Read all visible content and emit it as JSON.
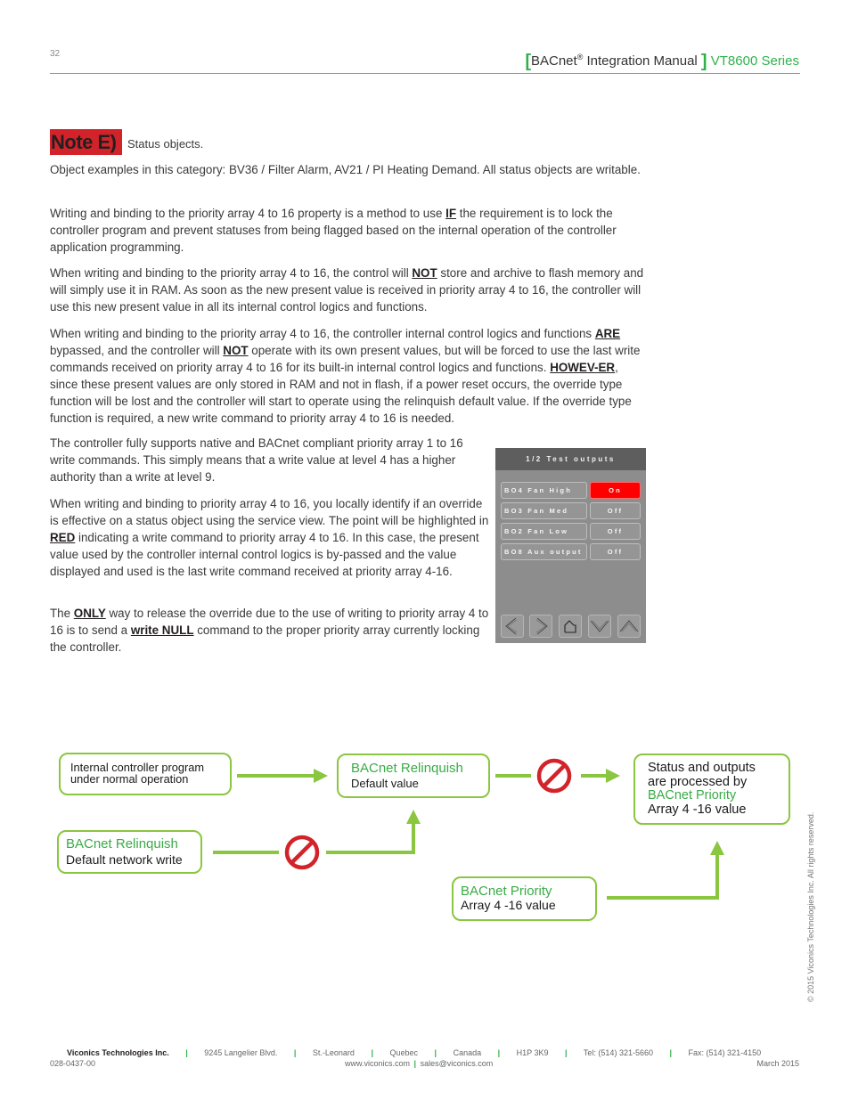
{
  "header": {
    "page_number": "32",
    "title_main": "BACnet",
    "title_reg": "®",
    "title_rest": " Integration Manual",
    "series": "VT8600 Series",
    "bracket_open": "[",
    "bracket_close": "]"
  },
  "note": {
    "badge": "Note E)",
    "subtitle": "Status objects."
  },
  "paragraphs": {
    "p1": "Object examples in this category: BV36 / Filter Alarm, AV21 / PI Heating Demand. All status objects are writable.",
    "p2a": "Writing and binding to the priority array 4 to 16 property is a method to use ",
    "p2b": "IF",
    "p2c": " the requirement is to lock the controller program and prevent statuses from being flagged based on the internal operation of the controller application programming.",
    "p3a": "When writing and binding to the priority array 4 to 16, the control will ",
    "p3b": "NOT",
    "p3c": " store and archive to flash memory and will simply use it in RAM. As soon as the new present value is received in priority array 4 to 16, the controller will use this new present value in all its internal control logics and functions.",
    "p4a": "When writing and binding to the priority array 4 to 16, the controller internal control logics and functions ",
    "p4b": "ARE",
    "p4c": " bypassed, and the controller will ",
    "p4d": "NOT",
    "p4e": " operate with its own present values, but will be forced to use the last write commands received on priority array 4 to 16 for its built-in internal control logics and functions. ",
    "p4f": "HOWEV-ER",
    "p4g": ", since these present values are only stored in RAM and not in flash, if a power reset occurs, the override type function will be lost and the controller will start to operate using the relinquish default value. If the override type function is required, a new write command to priority array 4 to 16 is needed.",
    "p5": "The controller fully supports native and BACnet compliant priority array 1 to 16 write commands. This simply means that a write value at level 4 has a higher authority than a write at level 9.",
    "p6a": "When writing and binding to priority array 4 to 16, you locally identify if an override is effective on a  status object using the service view. The point will be highlighted in ",
    "p6b": "RED",
    "p6c": " indicating a write command to priority array 4 to 16. In this case, the present value used by the controller internal control logics is by-passed and the value displayed and used is the last write command received at priority array 4-16.",
    "p7a": "The ",
    "p7b": "ONLY",
    "p7c": " way to release the override due to the use of writing to priority array 4 to 16 is to send a ",
    "p7d": "write NULL",
    "p7e": " command to the proper priority array currently locking the controller."
  },
  "device": {
    "title": "1/2 Test outputs",
    "rows": [
      {
        "label": "BO4 Fan High",
        "value": "On",
        "state": "on"
      },
      {
        "label": "BO3 Fan Med",
        "value": "Off",
        "state": "off"
      },
      {
        "label": "BO2 Fan Low",
        "value": "Off",
        "state": "off"
      },
      {
        "label": "BO8 Aux output",
        "value": "Off",
        "state": "off"
      }
    ],
    "buttons": [
      "left-arrow-icon",
      "right-arrow-icon",
      "home-icon",
      "down-arrow-icon",
      "up-arrow-icon"
    ],
    "on_color": "#ff0000"
  },
  "flow": {
    "internal_program": {
      "line1": "Internal controller program",
      "line2": "under normal operation"
    },
    "relinquish_default": {
      "title": "BACnet Relinquish",
      "sub": "Default value"
    },
    "relinquish_network": {
      "title": "BACnet Relinquish",
      "sub": "Default network write"
    },
    "status_outputs": {
      "line1": "Status and outputs",
      "line2": "are processed by",
      "line3": "BACnet  Priority",
      "line4": "Array 4 -16 value"
    },
    "priority_array": {
      "title": "BACnet Priority",
      "sub": "Array 4 -16 value"
    },
    "accent_color": "#8ac640",
    "block_color": "#d2232a"
  },
  "footer": {
    "company": "Viconics Technologies Inc.",
    "address": "9245 Langelier Blvd.",
    "city": "St.-Leonard",
    "province": "Quebec",
    "country": "Canada",
    "postal": "H1P 3K9",
    "tel": "Tel: (514) 321-5660",
    "fax": "Fax: (514) 321-4150",
    "doc_number": "028-0437-00",
    "website": "www.viconics.com",
    "email": "sales@viconics.com",
    "date": "March 2015",
    "separator": "|",
    "copyright": "© 2015 Viconics Technologies Inc. All rights reserved."
  }
}
